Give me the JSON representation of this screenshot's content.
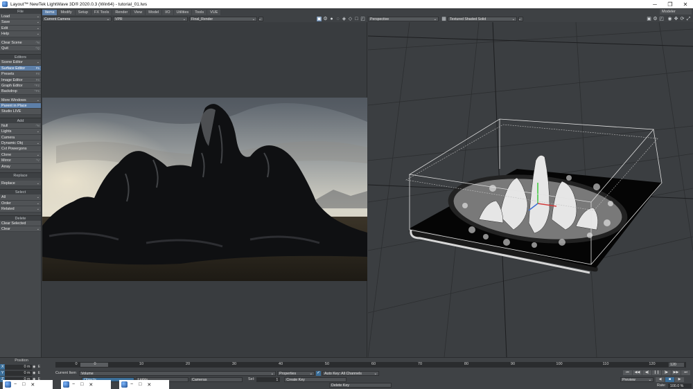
{
  "window": {
    "title": "Layout™ NewTek LightWave 3D® 2020.0.3 (Win64) - tutorial_01.lws",
    "min": "─",
    "max": "❐",
    "close": "✕"
  },
  "left_toolbar": {
    "file_header": "File",
    "file_items": [
      {
        "label": "Load",
        "dd": "⌄"
      },
      {
        "label": "Save",
        "dd": "⌄"
      },
      {
        "label": "Edit",
        "dd": "⌄"
      },
      {
        "label": "Help",
        "dd": "⌄"
      }
    ],
    "clear_scene": {
      "label": "Clear Scene",
      "sc": "^N"
    },
    "quit": {
      "label": "Quit",
      "sc": "^Q"
    },
    "editors_header": "Editors",
    "scene_editor": {
      "label": "Scene Editor",
      "dd": "⌄"
    },
    "surface_editor": {
      "label": "Surface Editor",
      "sc": "F5"
    },
    "presets": {
      "label": "Presets",
      "sc": "F8"
    },
    "image_editor": {
      "label": "Image Editor",
      "sc": "F6"
    },
    "graph_editor": {
      "label": "Graph Editor",
      "sc": "^F2"
    },
    "backdrop": {
      "label": "Backdrop",
      "sc": "^F5"
    },
    "more_windows": {
      "label": "More Windows",
      "dd": "⌄"
    },
    "parent_in_place": "Parent in Place",
    "studio_live": "Studio LIVE",
    "add_header": "Add",
    "add_items": [
      {
        "label": "Null",
        "sc": "^N"
      },
      {
        "label": "Lights",
        "dd": "⌄"
      },
      {
        "label": "Camera",
        "sc": ""
      },
      {
        "label": "Dynamic Obj",
        "dd": "⌄"
      },
      {
        "label": "Cvt Powergons",
        "sc": ""
      },
      {
        "label": "Clone",
        "dd": "⌄"
      },
      {
        "label": "Mirror",
        "sc": "^V"
      },
      {
        "label": "Array",
        "sc": ""
      }
    ],
    "replace_header": "Replace",
    "replace": {
      "label": "Replace",
      "dd": "⌄"
    },
    "select_header": "Select",
    "select_items": [
      {
        "label": "All",
        "dd": "⌄"
      },
      {
        "label": "Order",
        "dd": "⌄"
      },
      {
        "label": "Related",
        "dd": "⌄"
      }
    ],
    "delete_header": "Delete",
    "clear_selected": "Clear Selected",
    "clear": {
      "label": "Clear",
      "dd": "⌄"
    }
  },
  "menu_tabs": [
    "Items",
    "Modify",
    "Setup",
    "FX Tools",
    "Render",
    "View",
    "Model",
    "I/O",
    "Utilities",
    "Tools",
    "VUE"
  ],
  "active_tab": "Items",
  "modeler_button": "Modeler",
  "viewport_left": {
    "camera": "Current Camera",
    "mode": "VPR",
    "render": "Final_Render"
  },
  "viewport_right": {
    "view": "Perspective",
    "shading": "Textured Shaded Solid"
  },
  "timeline": {
    "position_label": "Position",
    "axes": [
      {
        "axis": "X",
        "value": "0 m"
      },
      {
        "axis": "Y",
        "value": "0 m"
      },
      {
        "axis": "Z",
        "value": "0 m"
      }
    ],
    "ruler_ticks": [
      "0",
      "10",
      "20",
      "30",
      "40",
      "50",
      "60",
      "70",
      "80",
      "90",
      "100",
      "110",
      "120"
    ],
    "scrub_frame": "0",
    "end_frame": "120",
    "current_item_label": "Current Item",
    "current_item": "Volume",
    "objects_tab": "Objects",
    "lights_tab": "Lights",
    "cameras_tab": "Cameras",
    "properties": "Properties",
    "sel_label": "Sel:",
    "sel_value": "1",
    "auto_key": "Auto Key: All Channels",
    "create_key": "Create Key",
    "delete_key": "Delete Key",
    "preview": "Preview",
    "rate_label": "Rate:",
    "rate_value": "100.0 %"
  },
  "taskbar_windows": [
    {
      "left": "−"
    },
    {
      "left": "−"
    },
    {
      "left": "−"
    }
  ]
}
